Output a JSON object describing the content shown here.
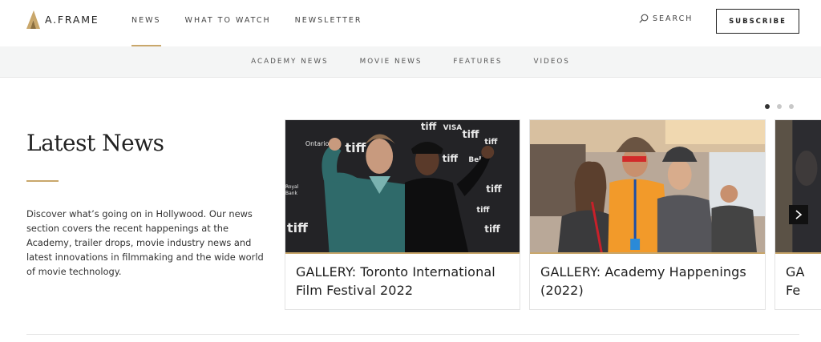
{
  "brand": {
    "name": "A.FRAME"
  },
  "nav": {
    "items": [
      "NEWS",
      "WHAT TO WATCH",
      "NEWSLETTER"
    ],
    "active": "NEWS",
    "search_label": "SEARCH",
    "subscribe_label": "SUBSCRIBE"
  },
  "subnav": {
    "items": [
      "ACADEMY NEWS",
      "MOVIE NEWS",
      "FEATURES",
      "VIDEOS"
    ]
  },
  "intro": {
    "title": "Latest News",
    "description": "Discover what’s going on in Hollywood. Our news section covers the recent happenings at the Academy, trailer drops, movie industry news and latest innovations in filmmaking and the wide world of movie technology."
  },
  "carousel": {
    "slides_total": 3,
    "active_slide": 1,
    "cards": [
      {
        "title": "GALLERY: Toronto International Film Festival 2022"
      },
      {
        "title": "GALLERY: Academy Happenings (2022)"
      },
      {
        "title": "GA Fe"
      }
    ]
  },
  "colors": {
    "accent": "#c9a76b",
    "text": "#222222",
    "subnav_bg": "#f4f5f5"
  }
}
